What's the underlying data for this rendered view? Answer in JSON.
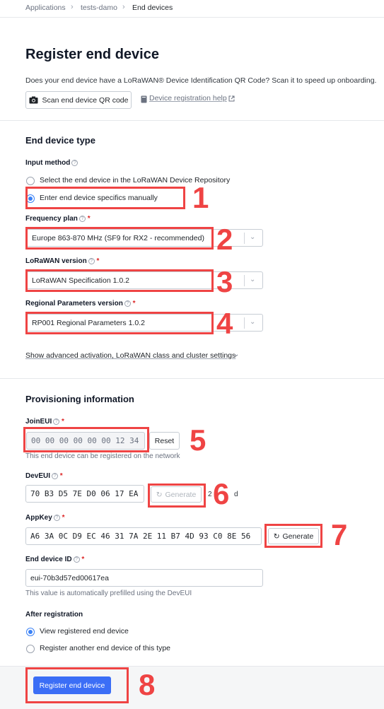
{
  "breadcrumb": {
    "items": [
      "Applications",
      "tests-damo",
      "End devices"
    ],
    "separator": "›"
  },
  "page_title": "Register end device",
  "intro": {
    "text": "Does your end device have a LoRaWAN® Device Identification QR Code? Scan it to speed up onboarding.",
    "scan_button": "Scan end device QR code",
    "help_link": "Device registration help"
  },
  "device_type": {
    "title": "End device type",
    "input_method_label": "Input method",
    "options": [
      "Select the end device in the LoRaWAN Device Repository",
      "Enter end device specifics manually"
    ],
    "selected_index": 1,
    "frequency_plan": {
      "label": "Frequency plan",
      "value": "Europe 863-870 MHz (SF9 for RX2 - recommended)"
    },
    "lorawan_version": {
      "label": "LoRaWAN version",
      "value": "LoRaWAN Specification 1.0.2"
    },
    "regional_params": {
      "label": "Regional Parameters version",
      "value": "RP001 Regional Parameters 1.0.2"
    },
    "advanced_link": "Show advanced activation, LoRaWAN class and cluster settings"
  },
  "provisioning": {
    "title": "Provisioning information",
    "join_eui": {
      "label": "JoinEUI",
      "value": "00 00 00 00 00 00 12 34",
      "reset_button": "Reset",
      "hint": "This end device can be registered on the network"
    },
    "dev_eui": {
      "label": "DevEUI",
      "value": "70 B3 D5 7E D0 06 17 EA",
      "generate_button": "Generate",
      "counter": "2",
      "counter_suffix": "d"
    },
    "app_key": {
      "label": "AppKey",
      "value": "A6 3A 0C D9 EC 46 31 7A 2E 11 B7 4D 93 C0 8E 56",
      "generate_button": "Generate"
    },
    "end_device_id": {
      "label": "End device ID",
      "value": "eui-70b3d57ed00617ea",
      "hint": "This value is automatically prefilled using the DevEUI"
    }
  },
  "after_registration": {
    "label": "After registration",
    "options": [
      "View registered end device",
      "Register another end device of this type"
    ],
    "selected_index": 0
  },
  "submit_button": "Register end device",
  "annotations": [
    "1",
    "2",
    "3",
    "4",
    "5",
    "6",
    "7",
    "8"
  ],
  "icons": {
    "scan": "camera-icon",
    "help": "book-icon",
    "external": "external-link-icon",
    "help_circle": "question-circle-icon",
    "chevron": "chevron-down-icon",
    "refresh": "refresh-icon"
  },
  "colors": {
    "primary": "#3b6ef6",
    "annotation": "#ef4444",
    "required": "#dc2626"
  }
}
